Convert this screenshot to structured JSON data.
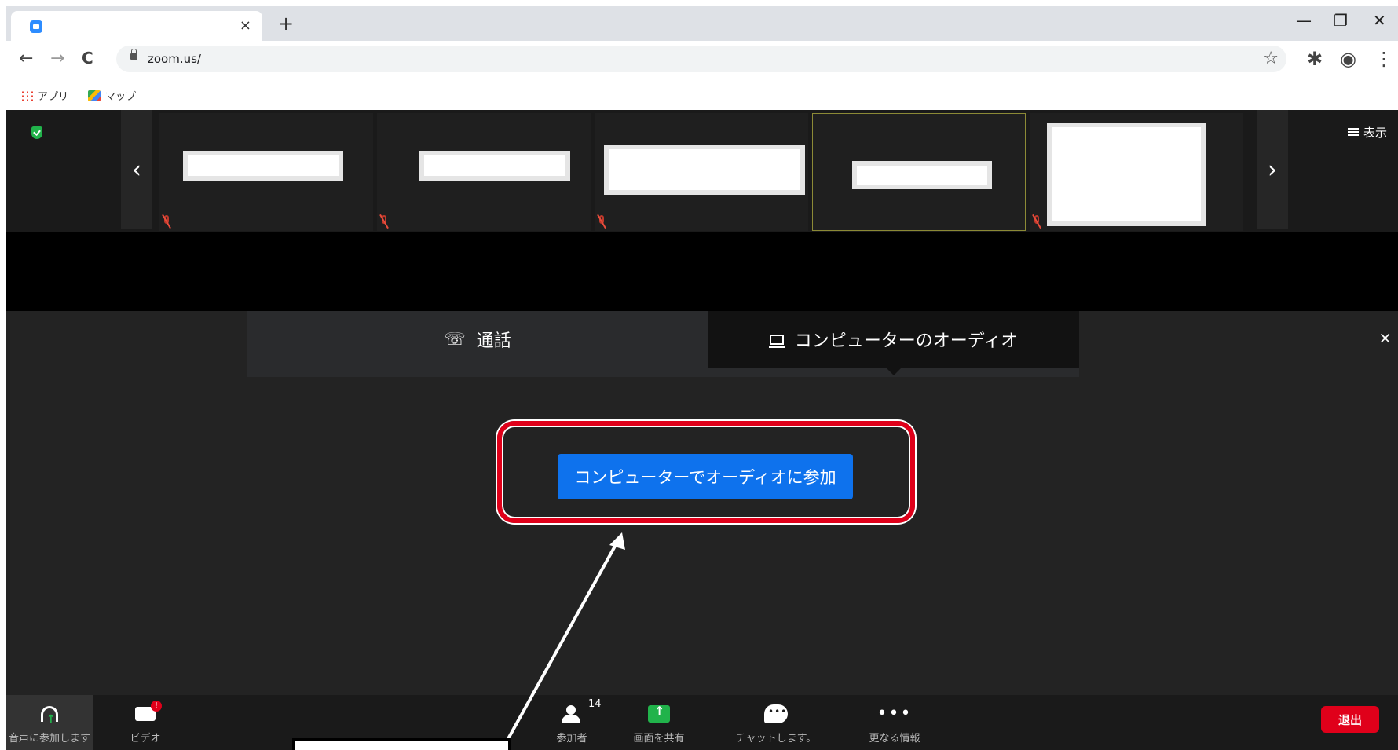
{
  "browser": {
    "tab": {
      "close_glyph": "×"
    },
    "new_tab_glyph": "+",
    "window": {
      "minimize": "—",
      "restore": "❐",
      "close": "✕"
    },
    "nav": {
      "back": "←",
      "forward": "→",
      "reload": "C"
    },
    "url": "zoom.us/",
    "bookmark_star": "☆",
    "extensions": "✱",
    "profile": "◉",
    "menu": "⋮",
    "bookmarks": [
      {
        "label": "アプリ"
      },
      {
        "label": "マップ"
      }
    ]
  },
  "meeting": {
    "filmstrip": {
      "prev_arrow": "‹",
      "next_arrow": "›",
      "view_label": "表示",
      "tiles": 5
    },
    "audio_dialog": {
      "tabs": [
        {
          "icon": "☏",
          "label": "通話"
        },
        {
          "label": "コンピューターのオーディオ"
        }
      ],
      "close_glyph": "×",
      "join_button_label": "コンピューターでオーディオに参加"
    },
    "toolbar": {
      "audio_label": "音声に参加します",
      "video_label": "ビデオ",
      "participants_label": "参加者",
      "participants_count": "14",
      "share_label": "画面を共有",
      "chat_label": "チャットします。",
      "more_label": "更なる情報",
      "more_glyph": "•••",
      "leave_label": "退出"
    }
  },
  "colors": {
    "accent_blue": "#0e72ed",
    "highlight_red": "#e0001a",
    "security_green": "#21b34b",
    "meeting_bg": "#232323"
  }
}
